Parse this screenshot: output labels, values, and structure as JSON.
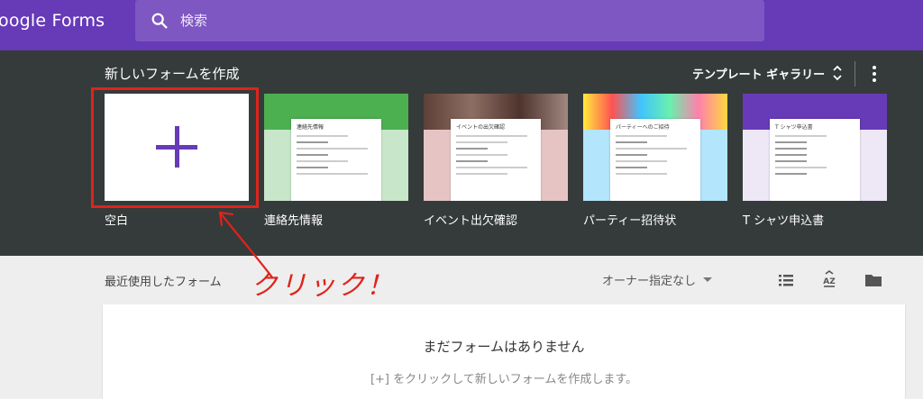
{
  "app": {
    "title": "oogle Forms"
  },
  "search": {
    "placeholder": "検索",
    "value": ""
  },
  "gallery": {
    "title": "新しいフォームを作成",
    "toggle_label": "テンプレート ギャラリー",
    "templates": [
      {
        "label": "空白",
        "thumb_title": "",
        "colors": [
          "#ffffff",
          "#ffffff"
        ]
      },
      {
        "label": "連絡先情報",
        "thumb_title": "連絡先情報",
        "colors": [
          "#4caf50",
          "#c8e6c9"
        ]
      },
      {
        "label": "イベント出欠確認",
        "thumb_title": "イベントの出欠確認",
        "colors": [
          "#5d4037",
          "#e6c4c4"
        ]
      },
      {
        "label": "パーティー招待状",
        "thumb_title": "パーティーへのご招待",
        "colors": [
          "#ff8a65",
          "#b3e5fc"
        ]
      },
      {
        "label": "T シャツ申込書",
        "thumb_title": "T シャツ申込書",
        "colors": [
          "#673ab7",
          "#ede7f6"
        ]
      }
    ]
  },
  "recent": {
    "title": "最近使用したフォーム",
    "owner_filter": "オーナー指定なし",
    "empty_title": "まだフォームはありません",
    "empty_subtitle": "[+] をクリックして新しいフォームを作成します。"
  },
  "annotation": {
    "text": "クリック！",
    "color": "#e0231c"
  },
  "colors": {
    "brand": "#673ab7",
    "gallery_bg": "#353b3a",
    "page_bg": "#eeeeee"
  },
  "icons": [
    "search-icon",
    "unfold-icon",
    "more-vert-icon",
    "list-view-icon",
    "sort-az-icon",
    "folder-icon",
    "plus-icon"
  ]
}
